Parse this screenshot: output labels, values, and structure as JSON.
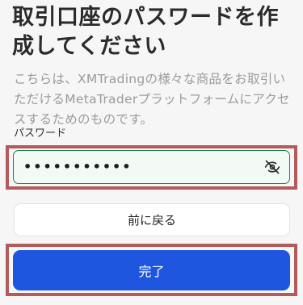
{
  "header": {
    "title": "取引口座のパスワードを作成してください"
  },
  "description": "こちらは、XMTradingの様々な商品をお取引いただけるMetaTraderプラットフォームにアクセスするためのものです。",
  "password": {
    "label": "パスワード",
    "value": "•••••••••••",
    "visibility_icon": "eye-off-icon",
    "border_color": "#1f7a4c"
  },
  "actions": {
    "back_label": "前に戻る",
    "complete_label": "完了",
    "complete_color": "#1f56e0"
  },
  "annotation": {
    "highlight_color": "#b25b5a"
  }
}
